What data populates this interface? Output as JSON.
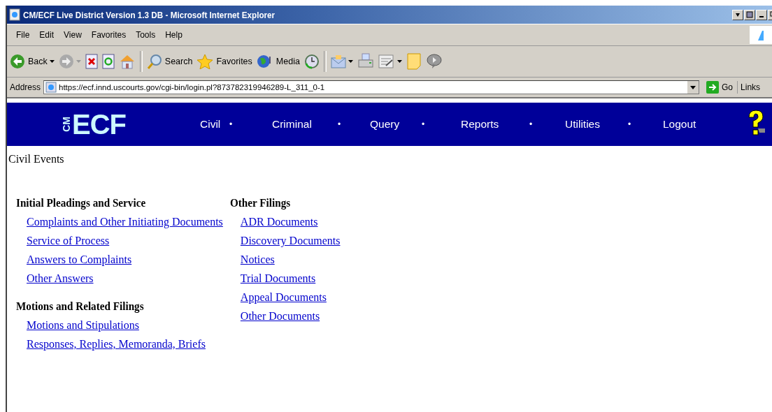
{
  "window": {
    "title": "CM/ECF Live District Version 1.3 DB - Microsoft Internet Explorer"
  },
  "menu": [
    "File",
    "Edit",
    "View",
    "Favorites",
    "Tools",
    "Help"
  ],
  "toolbar": [
    {
      "kind": "back",
      "label": "Back"
    },
    {
      "kind": "forward"
    },
    {
      "kind": "stop"
    },
    {
      "kind": "refresh"
    },
    {
      "kind": "home"
    },
    {
      "kind": "sep"
    },
    {
      "kind": "search",
      "label": "Search"
    },
    {
      "kind": "favorites",
      "label": "Favorites"
    },
    {
      "kind": "media",
      "label": "Media"
    },
    {
      "kind": "history"
    },
    {
      "kind": "sep"
    },
    {
      "kind": "mail"
    },
    {
      "kind": "print"
    },
    {
      "kind": "edit"
    },
    {
      "kind": "note"
    },
    {
      "kind": "messenger"
    }
  ],
  "address": {
    "label": "Address",
    "value": "https://ecf.innd.uscourts.gov/cgi-bin/login.pl?873782319946289-L_311_0-1",
    "go": "Go",
    "links": "Links"
  },
  "banner": {
    "logo_small": "CM",
    "logo": "ECF",
    "nav": [
      "Civil",
      "Criminal",
      "Query",
      "Reports",
      "Utilities",
      "Logout"
    ],
    "separator": "•"
  },
  "page_title": "Civil Events",
  "columns": [
    {
      "groups": [
        {
          "heading": "Initial Pleadings and Service",
          "links": [
            "Complaints and Other Initiating Documents",
            "Service of Process",
            "Answers to Complaints",
            "Other Answers"
          ]
        },
        {
          "heading": "Motions and Related Filings",
          "links": [
            "Motions and Stipulations",
            "Responses, Replies, Memoranda, Briefs"
          ]
        }
      ]
    },
    {
      "groups": [
        {
          "heading": "Other Filings",
          "links": [
            "ADR Documents",
            "Discovery Documents",
            "Notices",
            "Trial Documents",
            "Appeal Documents",
            "Other Documents"
          ]
        }
      ]
    }
  ]
}
